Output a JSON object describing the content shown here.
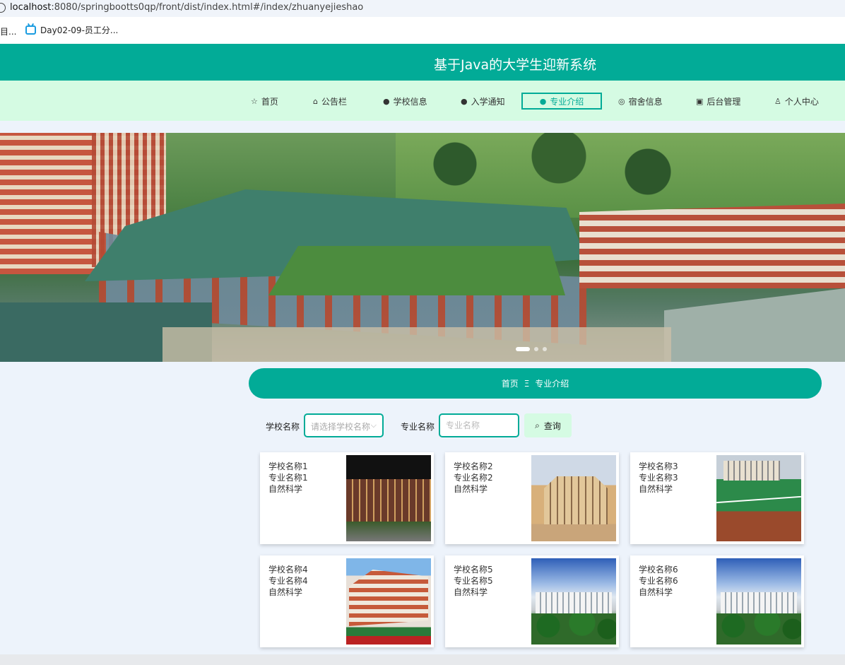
{
  "browser": {
    "url_host": "localhost",
    "url_rest": ":8080/springbootts0qp/front/dist/index.html#/index/zhuanyejieshao",
    "bookmark_left": "目...",
    "bookmark_item": "Day02-09-员工分..."
  },
  "header": {
    "title": "基于Java的大学生迎新系统"
  },
  "nav": {
    "items": [
      {
        "label": "首页",
        "icon": "star-icon"
      },
      {
        "label": "公告栏",
        "icon": "bag-icon"
      },
      {
        "label": "学校信息",
        "icon": "alert-circle-icon"
      },
      {
        "label": "入学通知",
        "icon": "question-circle-icon"
      },
      {
        "label": "专业介绍",
        "icon": "info-circle-icon",
        "active": true
      },
      {
        "label": "宿舍信息",
        "icon": "target-icon"
      },
      {
        "label": "后台管理",
        "icon": "briefcase-icon"
      },
      {
        "label": "个人中心",
        "icon": "user-icon"
      }
    ]
  },
  "breadcrumb": {
    "home": "首页",
    "separator": "Ξ",
    "current": "专业介绍"
  },
  "search": {
    "school_label": "学校名称",
    "school_placeholder": "请选择学校名称",
    "major_label": "专业名称",
    "major_placeholder": "专业名称",
    "button_label": "查询"
  },
  "cards": [
    {
      "school": "学校名称1",
      "major": "专业名称1",
      "category": "自然科学"
    },
    {
      "school": "学校名称2",
      "major": "专业名称2",
      "category": "自然科学"
    },
    {
      "school": "学校名称3",
      "major": "专业名称3",
      "category": "自然科学"
    },
    {
      "school": "学校名称4",
      "major": "专业名称4",
      "category": "自然科学"
    },
    {
      "school": "学校名称5",
      "major": "专业名称5",
      "category": "自然科学"
    },
    {
      "school": "学校名称6",
      "major": "专业名称6",
      "category": "自然科学"
    }
  ],
  "colors": {
    "primary": "#02ab97",
    "nav_bg": "#d5fbe3",
    "page_bg": "#edf3fb"
  }
}
